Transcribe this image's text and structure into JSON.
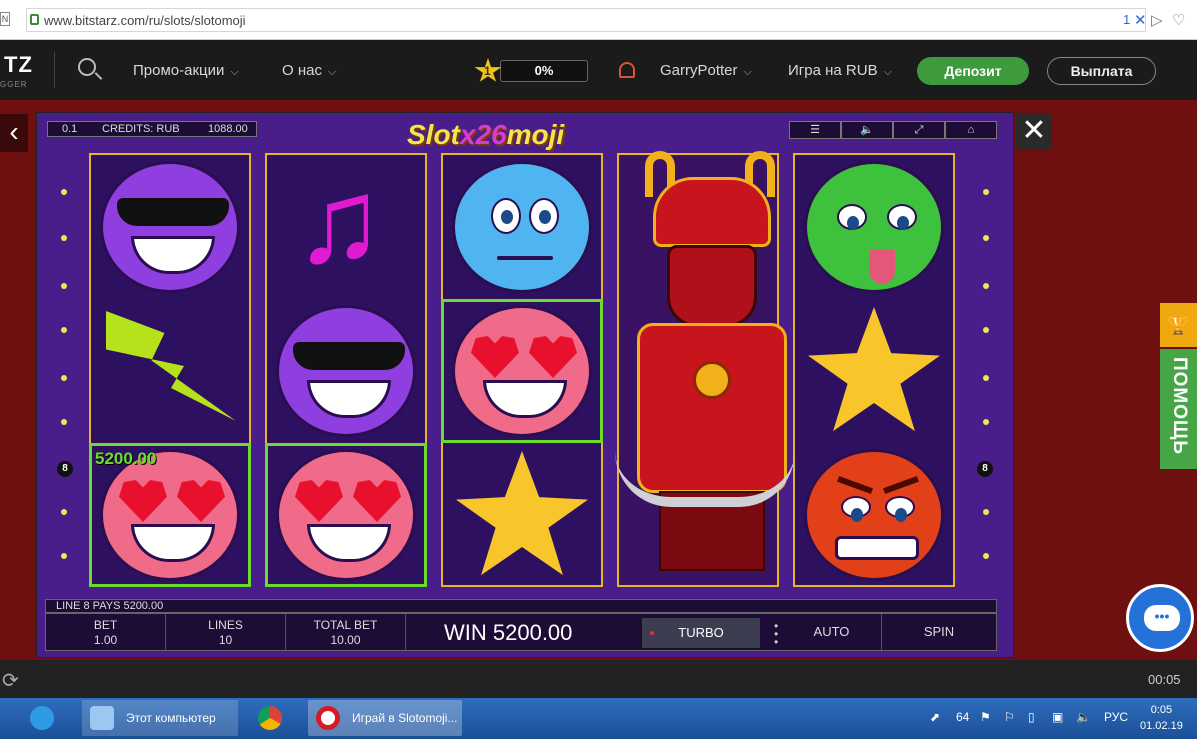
{
  "browser": {
    "url": "www.bitstarz.com/ru/slots/slotomoji",
    "tab_edge": "N",
    "badge": "1"
  },
  "site": {
    "logo": "TZ",
    "logo_sub": "GGER",
    "nav": [
      "Промо-акции",
      "О нас"
    ],
    "level": "1",
    "progress": "0%",
    "progress_value": 0,
    "username": "GarryPotter",
    "currency_mode": "Игра на RUB",
    "deposit": "Депозит",
    "withdraw": "Выплата"
  },
  "game": {
    "coin": "0.1",
    "credits_label": "CREDITS: RUB",
    "credits": "1088.00",
    "title_left": "Slot",
    "title_mid": "x26",
    "title_right": "moji",
    "line_left": "8",
    "line_right": "8",
    "win_amount_tag": "5200.00",
    "line_pays": "LINE 8 PAYS 5200.00",
    "bet_label": "BET",
    "bet": "1.00",
    "lines_label": "LINES",
    "lines": "10",
    "total_bet_label": "TOTAL BET",
    "total_bet": "10.00",
    "win": "WIN 5200.00",
    "turbo": "TURBO",
    "auto": "AUTO",
    "spin": "SPIN",
    "reels": [
      [
        "cool-purple",
        "lightning",
        "love-pink"
      ],
      [
        "music-note",
        "cool-purple",
        "love-pink"
      ],
      [
        "sad-blue",
        "love-pink",
        "star"
      ],
      [
        "samurai-wild"
      ],
      [
        "sick-green",
        "star",
        "angry-red"
      ]
    ]
  },
  "side": {
    "help": "ПОМОЩЬ"
  },
  "player": {
    "time": "00:05"
  },
  "taskbar": {
    "explorer": "Этот компьютер",
    "opera": "Играй в Slotomoji...",
    "lang": "РУС",
    "tray_num": "64",
    "time": "0:05",
    "date": "01.02.19"
  },
  "colors": {
    "deposit": "#3d9a3d",
    "win_line": "#6cdc2a",
    "reel_border": "#e6b620",
    "game_bg": "#4a1e8a"
  }
}
